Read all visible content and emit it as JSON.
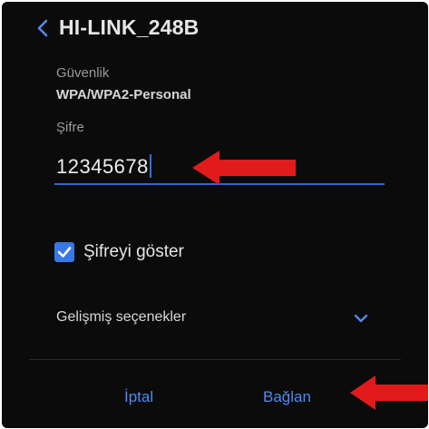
{
  "header": {
    "title": "HI-LINK_248B",
    "back_icon": "chevron-left-icon"
  },
  "security": {
    "label": "Güvenlik",
    "value": "WPA/WPA2-Personal"
  },
  "password": {
    "label": "Şifre",
    "value": "12345678"
  },
  "show_password": {
    "label": "Şifreyi göster",
    "checked": true
  },
  "advanced": {
    "label": "Gelişmiş seçenekler",
    "icon": "chevron-down-icon"
  },
  "buttons": {
    "cancel": "İptal",
    "connect": "Bağlan"
  },
  "colors": {
    "background": "#0b0b0b",
    "accent": "#3978e4",
    "annotation_arrow": "#e11b1b"
  }
}
